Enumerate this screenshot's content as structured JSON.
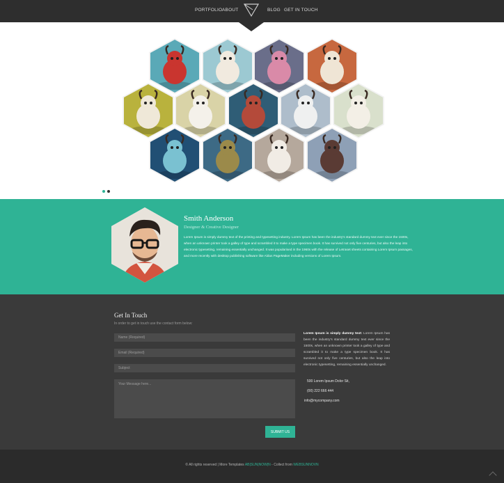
{
  "nav": {
    "items": [
      "PORTFOLIO",
      "ABOUT",
      "BLOG",
      "GET IN TOUCH"
    ],
    "logo_icon": "triangle-logo-icon"
  },
  "hero": {
    "gallery": [
      {
        "icon": "red-monster-illustration",
        "bg": "#5aa9b7",
        "fg": "#c9352f"
      },
      {
        "icon": "white-beast-illustration",
        "bg": "#9cc9d2",
        "fg": "#f1eadf"
      },
      {
        "icon": "pink-creature-illustration",
        "bg": "#6a6e8a",
        "fg": "#d98aa8"
      },
      {
        "icon": "horned-yeti-illustration",
        "bg": "#c7683f",
        "fg": "#efe5d5"
      },
      {
        "icon": "white-dog-illustration",
        "bg": "#b9b23d",
        "fg": "#efe8d8"
      },
      {
        "icon": "polar-bear-illustration",
        "bg": "#d9d3a7",
        "fg": "#f4f1ea"
      },
      {
        "icon": "masked-warrior-illustration",
        "bg": "#2f5d76",
        "fg": "#b44a3a"
      },
      {
        "icon": "twin-creatures-illustration",
        "bg": "#aebdcb",
        "fg": "#eff0f0"
      },
      {
        "icon": "furry-yeti-illustration",
        "bg": "#d9e0cc",
        "fg": "#f3efe6"
      },
      {
        "icon": "jellyfish-illustration",
        "bg": "#214f74",
        "fg": "#7ac1d1"
      },
      {
        "icon": "tiki-mask-illustration",
        "bg": "#3d6a85",
        "fg": "#9b8a4a"
      },
      {
        "icon": "bird-monster-illustration",
        "bg": "#b5a89c",
        "fg": "#f1ece5"
      },
      {
        "icon": "horned-bull-illustration",
        "bg": "#8ea0b6",
        "fg": "#5a3b34"
      }
    ],
    "slider_dots": [
      "dot-1",
      "dot-2"
    ]
  },
  "profile": {
    "name": "Smith Anderson",
    "title": "Designer & Creative Designer",
    "bio": "Lorem Ipsum is simply dummy text of the printing and typesetting industry. Lorem Ipsum has been the industry's standard dummy text ever since the 1500s, when an unknown printer took a galley of type and scrambled it to make a type specimen book. It has survived not only five centuries, but also the leap into electronic typesetting, remaining essentially unchanged. It was popularised in the 1960s with the release of Letraset sheets containing Lorem Ipsum passages, and more recently with desktop publishing software like Aldus PageMaker including versions of Lorem Ipsum.",
    "avatar_icon": "person-avatar"
  },
  "contact": {
    "title": "Get In Touch",
    "subtitle": "In order to get in touch use the contact form below:",
    "name_placeholder": "Name (Required)",
    "email_placeholder": "Email (Required)",
    "subject_placeholder": "Subject",
    "message_placeholder": "Your Message here...",
    "submit_label": "SUBMIT US",
    "side_heading": "Lorem Ipsum is simply dummy text:",
    "side_body": "Lorem Ipsum has been the industry's standard dummy text ever since the 1500s, when an unknown printer took a galley of type and scrambled it to make a type specimen book. It has survived not only five centuries, but also the leap into electronic typesetting, remaining essentially unchanged.",
    "address": "500 Lorem Ipsum Dolor Sit,",
    "phone": "(00) 222 666 444",
    "email": "info@mycompany.com"
  },
  "footer": {
    "copyright": "© All rights reserved | More Templates",
    "link1": "AB|SUN|NOW|N",
    "collect": "- Collect from",
    "link2": "WEBSUNNOVN"
  },
  "colors": {
    "accent": "#2fb395",
    "nav_bg": "#2e2e2e",
    "contact_bg": "#3a3a3a",
    "footer_bg": "#2b2b2b"
  }
}
